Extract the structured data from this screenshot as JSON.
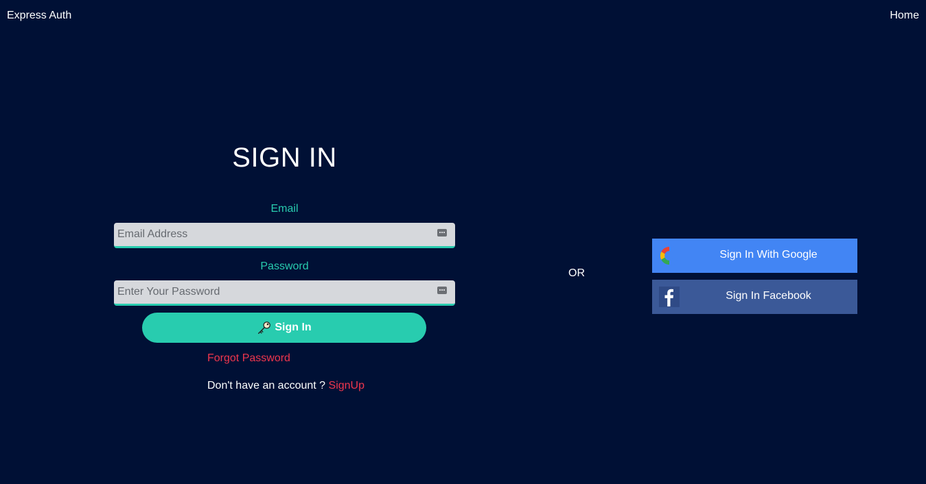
{
  "nav": {
    "brand": "Express Auth",
    "home": "Home"
  },
  "form": {
    "title": "SIGN IN",
    "email_label": "Email",
    "email_placeholder": "Email Address",
    "password_label": "Password",
    "password_placeholder": "Enter Your Password",
    "submit_label": "Sign In",
    "forgot_label": "Forgot Password",
    "no_account_text": "Don't have an account ? ",
    "signup_label": "SignUp"
  },
  "divider": {
    "or_text": "OR"
  },
  "social": {
    "google_label": "Sign In With Google",
    "facebook_label": "Sign In Facebook"
  },
  "colors": {
    "background": "#001035",
    "accent": "#28ccaf",
    "link": "#f0364d",
    "google": "#4285f4",
    "facebook": "#3b5998"
  },
  "icons": {
    "submit": "key-icon",
    "email_field": "autofill-icon",
    "password_field": "autofill-icon",
    "google": "google-g-icon",
    "facebook": "facebook-f-icon"
  }
}
